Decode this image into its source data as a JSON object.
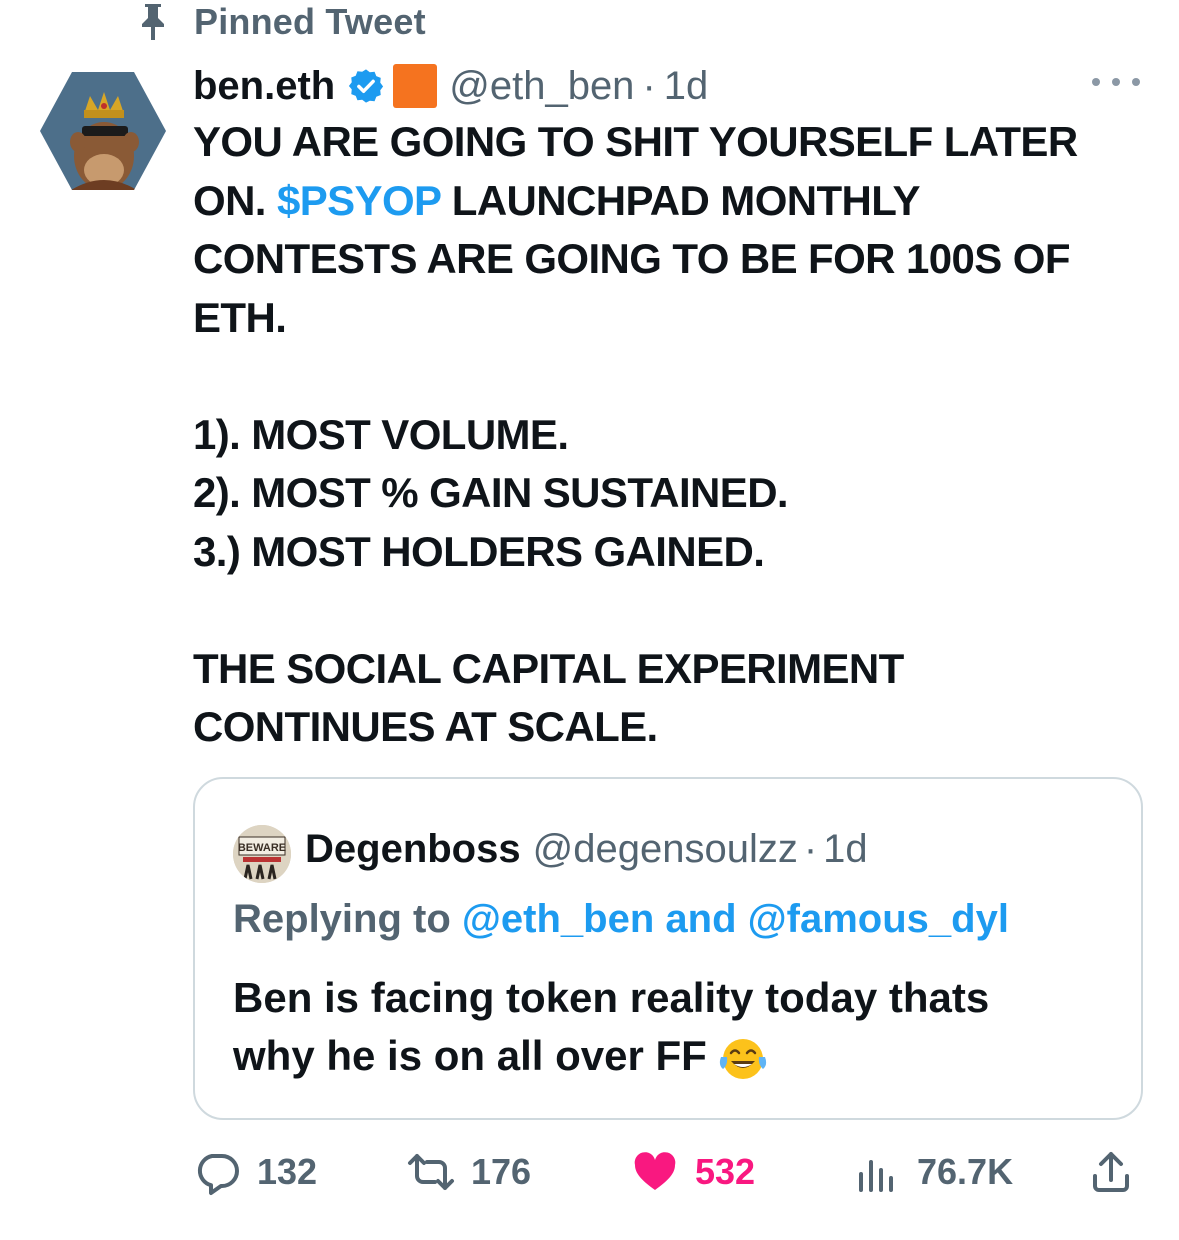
{
  "pinned": {
    "label": "Pinned Tweet"
  },
  "author": {
    "display_name": "ben.eth",
    "handle": "@eth_ben",
    "separator": "·",
    "time": "1d"
  },
  "tweet": {
    "lines": [
      "YOU ARE GOING TO SHIT YOURSELF LATER",
      "ON.",
      "LAUNCHPAD MONTHLY",
      "CONTESTS ARE GOING TO BE FOR 100S OF",
      "ETH.",
      "1). MOST VOLUME.",
      "2). MOST % GAIN SUSTAINED.",
      "3.) MOST HOLDERS GAINED.",
      "THE SOCIAL CAPITAL EXPERIMENT",
      "CONTINUES AT SCALE."
    ],
    "cashtag": "$PSYOP"
  },
  "quote": {
    "display_name": "Degenboss",
    "handle": "@degensoulzz",
    "separator": "·",
    "time": "1d",
    "replying_prefix": "Replying to",
    "mention_1": "@eth_ben",
    "joiner": "and",
    "mention_2": "@famous_dyl",
    "lines": [
      "Ben is facing token reality today thats",
      "why he is on all over FF"
    ],
    "avatar_text": "BEWARE"
  },
  "actions": {
    "replies": "132",
    "retweets": "176",
    "likes": "532",
    "views": "76.7K"
  },
  "icons": {
    "pin": "pin-icon",
    "verified": "verified-badge-icon",
    "more": "more-icon",
    "reply": "reply-icon",
    "retweet": "retweet-icon",
    "like": "heart-icon",
    "views": "views-icon",
    "share": "share-icon",
    "emoji": "tears-of-joy-emoji"
  },
  "colors": {
    "accent": "#1d9bf0",
    "like": "#f91880",
    "secondary_text": "#536471",
    "orange_badge": "#f5731f"
  }
}
